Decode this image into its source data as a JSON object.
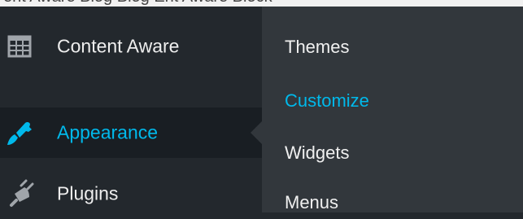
{
  "top_strip_text": "ent Aware Blog   Blog Ent Aware Block",
  "sidebar": {
    "items": [
      {
        "label": "Content Aware",
        "icon": "table-grid-icon"
      },
      {
        "label": "Appearance",
        "icon": "paint-brush-icon",
        "active": true
      },
      {
        "label": "Plugins",
        "icon": "plugin-icon"
      }
    ]
  },
  "submenu": {
    "items": [
      {
        "label": "Themes"
      },
      {
        "label": "Customize",
        "current": true
      },
      {
        "label": "Widgets"
      },
      {
        "label": "Menus"
      }
    ]
  },
  "colors": {
    "sidebar_bg": "#23282d",
    "active_bg": "#191e23",
    "submenu_bg": "#32373c",
    "accent": "#00b9eb",
    "text": "#eeeeee"
  }
}
